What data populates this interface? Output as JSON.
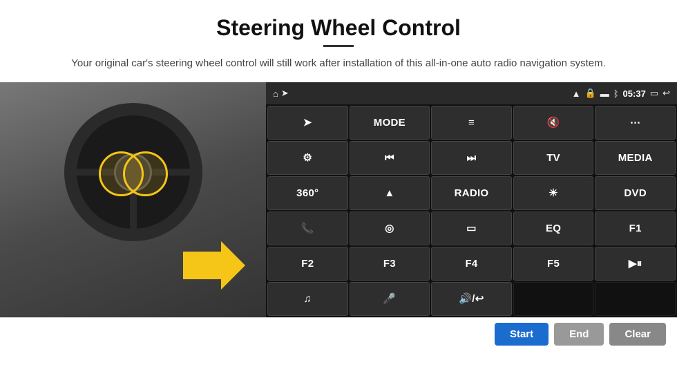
{
  "page": {
    "title": "Steering Wheel Control",
    "subtitle": "Your original car's steering wheel control will still work after installation of this all-in-one auto radio navigation system."
  },
  "status_bar": {
    "home_icon": "⌂",
    "wifi_icon": "WiFi",
    "lock_icon": "🔒",
    "sim_icon": "SIM",
    "bt_icon": "BT",
    "time": "05:37",
    "screen_icon": "▭",
    "back_icon": "↩"
  },
  "buttons": [
    {
      "id": "r1c1",
      "label": "➤",
      "type": "icon"
    },
    {
      "id": "r1c2",
      "label": "MODE",
      "type": "text"
    },
    {
      "id": "r1c3",
      "label": "≡",
      "type": "icon"
    },
    {
      "id": "r1c4",
      "label": "🔇",
      "type": "icon"
    },
    {
      "id": "r1c5",
      "label": "⋯",
      "type": "icon"
    },
    {
      "id": "r2c1",
      "label": "⚙",
      "type": "icon"
    },
    {
      "id": "r2c2",
      "label": "⏮",
      "type": "icon"
    },
    {
      "id": "r2c3",
      "label": "⏭",
      "type": "icon"
    },
    {
      "id": "r2c4",
      "label": "TV",
      "type": "text"
    },
    {
      "id": "r2c5",
      "label": "MEDIA",
      "type": "text"
    },
    {
      "id": "r3c1",
      "label": "360°",
      "type": "text"
    },
    {
      "id": "r3c2",
      "label": "▲",
      "type": "icon"
    },
    {
      "id": "r3c3",
      "label": "RADIO",
      "type": "text"
    },
    {
      "id": "r3c4",
      "label": "☀",
      "type": "icon"
    },
    {
      "id": "r3c5",
      "label": "DVD",
      "type": "text"
    },
    {
      "id": "r4c1",
      "label": "📞",
      "type": "icon"
    },
    {
      "id": "r4c2",
      "label": "◎",
      "type": "icon"
    },
    {
      "id": "r4c3",
      "label": "▭",
      "type": "icon"
    },
    {
      "id": "r4c4",
      "label": "EQ",
      "type": "text"
    },
    {
      "id": "r4c5",
      "label": "F1",
      "type": "text"
    },
    {
      "id": "r5c1",
      "label": "F2",
      "type": "text"
    },
    {
      "id": "r5c2",
      "label": "F3",
      "type": "text"
    },
    {
      "id": "r5c3",
      "label": "F4",
      "type": "text"
    },
    {
      "id": "r5c4",
      "label": "F5",
      "type": "text"
    },
    {
      "id": "r5c5",
      "label": "▶⏸",
      "type": "icon"
    },
    {
      "id": "r6c1",
      "label": "♫",
      "type": "icon"
    },
    {
      "id": "r6c2",
      "label": "🎤",
      "type": "icon"
    },
    {
      "id": "r6c3",
      "label": "🔊/↩",
      "type": "icon"
    },
    {
      "id": "r6c4",
      "label": "",
      "type": "empty"
    },
    {
      "id": "r6c5",
      "label": "",
      "type": "empty"
    }
  ],
  "bottom_bar": {
    "start_label": "Start",
    "end_label": "End",
    "clear_label": "Clear"
  }
}
